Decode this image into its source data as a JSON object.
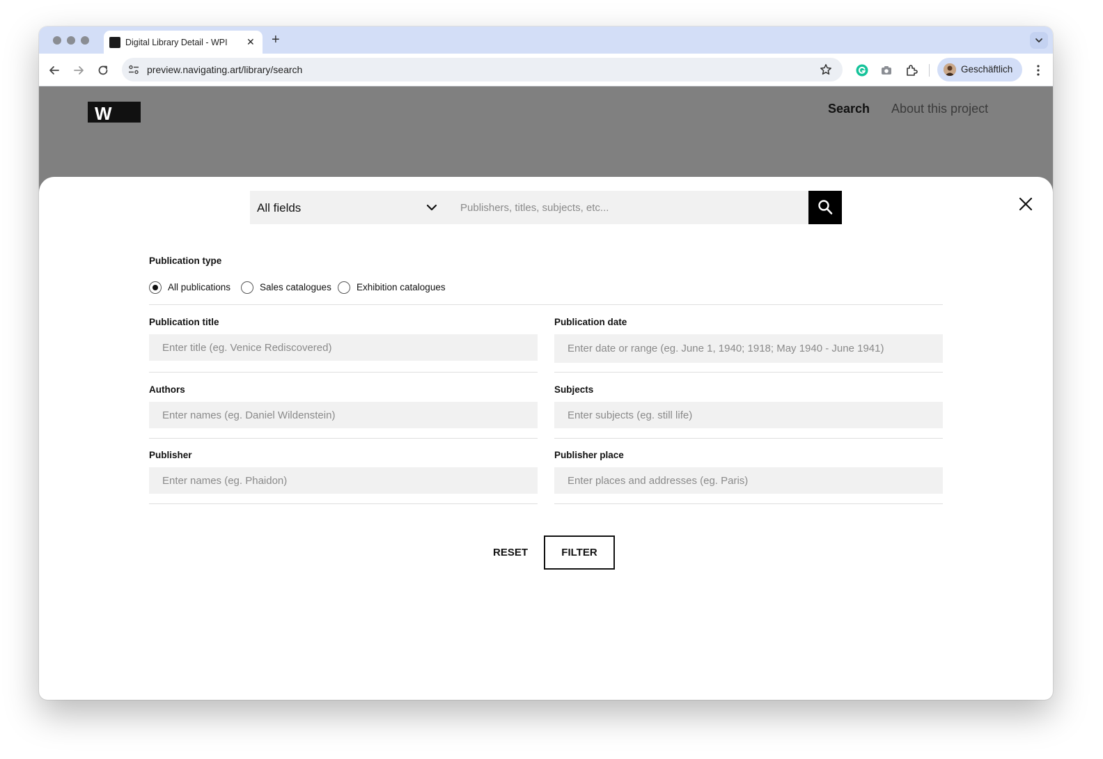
{
  "browser": {
    "tab_title": "Digital Library Detail - WPI",
    "url": "preview.navigating.art/library/search",
    "profile_name": "Geschäftlich"
  },
  "site": {
    "logo_text": "W",
    "nav": {
      "search": "Search",
      "about": "About this project"
    }
  },
  "search": {
    "field_selector": "All fields",
    "placeholder": "Publishers, titles, subjects, etc..."
  },
  "filters": {
    "publication_type_label": "Publication type",
    "publication_types": [
      {
        "label": "All publications",
        "checked": true
      },
      {
        "label": "Sales catalogues",
        "checked": false
      },
      {
        "label": "Exhibition catalogues",
        "checked": false
      }
    ],
    "publication_title": {
      "label": "Publication title",
      "placeholder": "Enter title (eg. Venice Rediscovered)"
    },
    "publication_date": {
      "label": "Publication date",
      "placeholder": "Enter date or range (eg. June 1, 1940; 1918; May 1940 - June 1941)"
    },
    "authors": {
      "label": "Authors",
      "placeholder": "Enter names (eg. Daniel Wildenstein)"
    },
    "subjects": {
      "label": "Subjects",
      "placeholder": "Enter subjects (eg. still life)"
    },
    "publisher": {
      "label": "Publisher",
      "placeholder": "Enter names (eg. Phaidon)"
    },
    "publisher_place": {
      "label": "Publisher place",
      "placeholder": "Enter places and addresses (eg. Paris)"
    }
  },
  "actions": {
    "reset": "RESET",
    "filter": "FILTER"
  }
}
